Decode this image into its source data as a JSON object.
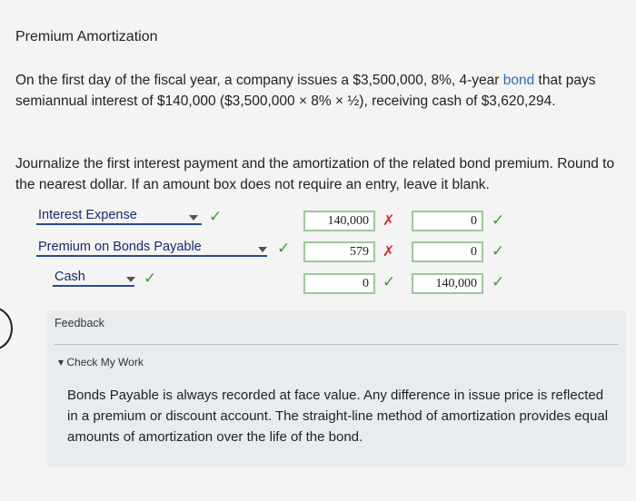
{
  "header": {
    "title": "Premium Amortization"
  },
  "problem": {
    "text_before_link": "On the first day of the fiscal year, a company issues a $3,500,000, 8%, 4-year ",
    "link_word": "bond",
    "text_after_link": " that pays semiannual interest of $140,000 ($3,500,000 × 8% × ½), receiving cash of $3,620,294.",
    "instructions": "Journalize the first interest payment and the amortization of the related bond premium. Round to the nearest dollar. If an amount box does not require an entry, leave it blank."
  },
  "journal": {
    "rows": [
      {
        "account": "Interest Expense",
        "debit": "140,000",
        "credit": "0",
        "account_status": "correct",
        "debit_status": "incorrect",
        "credit_status": "correct"
      },
      {
        "account": "Premium on Bonds Payable",
        "debit": "579",
        "credit": "0",
        "account_status": "correct",
        "debit_status": "incorrect",
        "credit_status": "correct"
      },
      {
        "account": "Cash",
        "debit": "0",
        "credit": "140,000",
        "account_status": "correct",
        "debit_status": "correct",
        "credit_status": "correct"
      }
    ]
  },
  "feedback": {
    "title": "Feedback",
    "toggle_label": "Check My Work",
    "text": "Bonds Payable is always recorded at face value. Any difference in issue price is reflected in a premium or discount account. The straight-line method of amortization provides equal amounts of amortization over the life of the bond."
  },
  "colors": {
    "correct": "#3e9b38",
    "incorrect": "#d0312d",
    "link": "#2a6fb0",
    "input_border": "#9cc89a"
  }
}
